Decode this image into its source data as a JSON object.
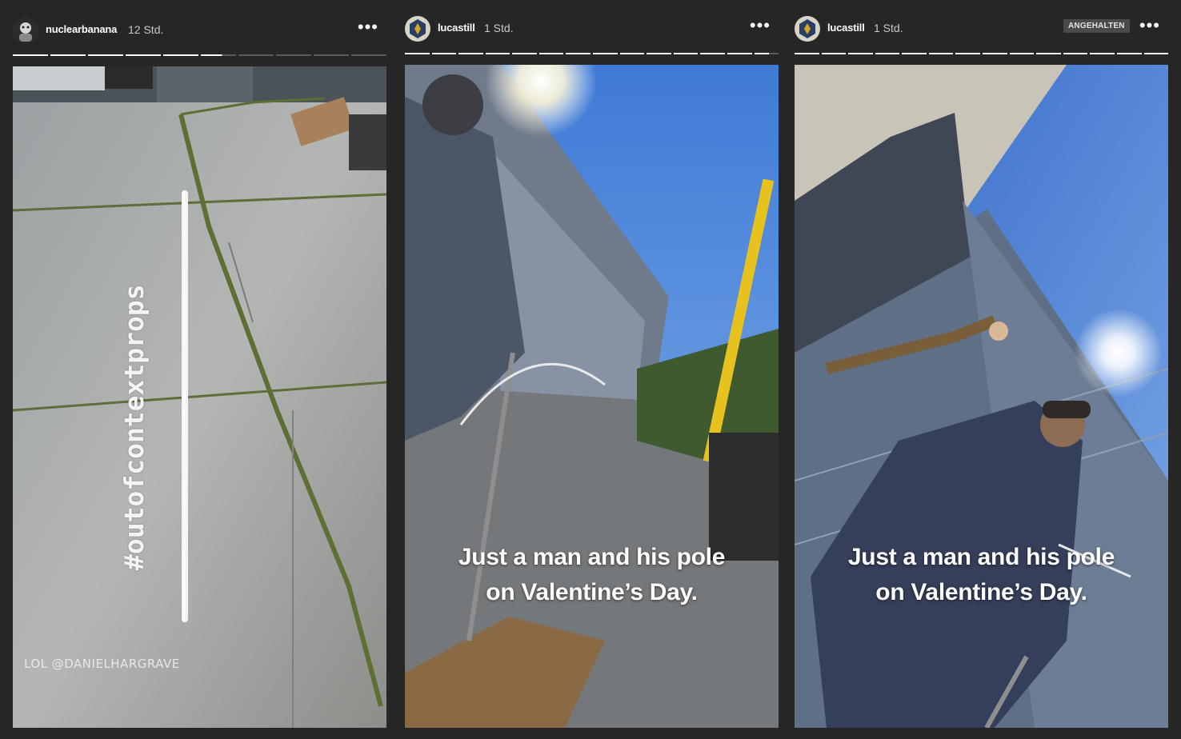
{
  "stories": [
    {
      "username": "nuclearbanana",
      "timestamp": "12 Std.",
      "more_label": "•••",
      "progress": {
        "segments": 10,
        "completed": 5.6
      },
      "hashtag": "#outofcontextprops",
      "mention": "LOL @DANIELHARGRAVE"
    },
    {
      "username": "lucastill",
      "timestamp": "1 Std.",
      "more_label": "•••",
      "progress": {
        "segments": 14,
        "completed": 13.6
      },
      "caption_line1": "Just a man and his pole",
      "caption_line2": "on Valentine’s Day."
    },
    {
      "username": "lucastill",
      "timestamp": "1 Std.",
      "more_label": "•••",
      "badge": "ANGEHALTEN",
      "progress": {
        "segments": 14,
        "completed": 14
      },
      "caption_line1": "Just a man and his pole",
      "caption_line2": "on Valentine’s Day."
    }
  ],
  "colors": {
    "background": "#262626",
    "progress_done": "#ffffff",
    "progress_pending": "#5a5a5a",
    "badge_bg": "#4a4a4a"
  }
}
